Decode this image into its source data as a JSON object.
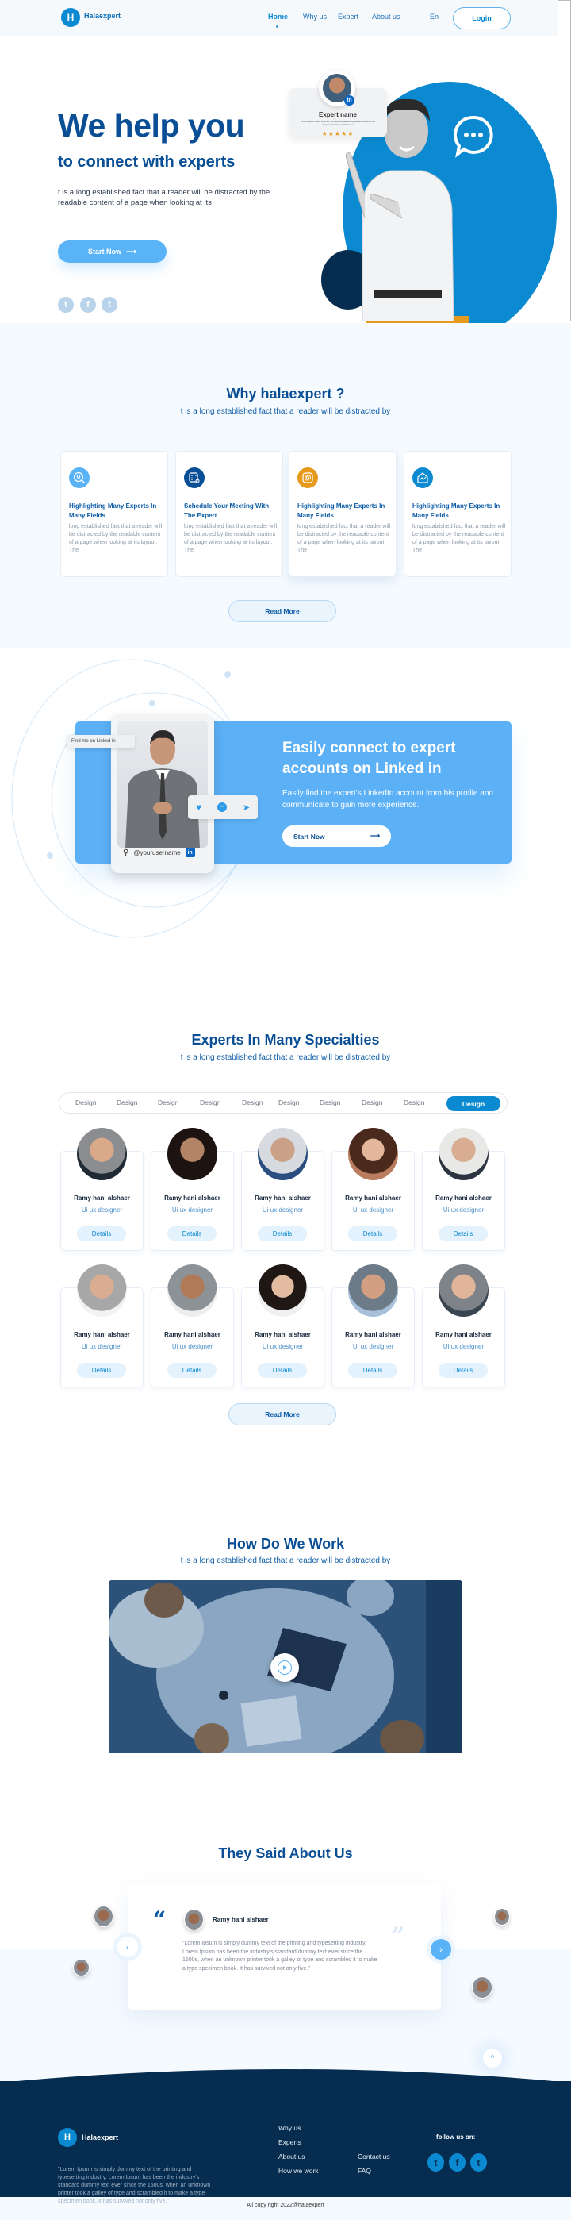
{
  "nav": {
    "brand_initial": "H",
    "brand": "Halaexpert",
    "links": [
      "Home",
      "Why us",
      "Expert",
      "About us"
    ],
    "active": "Home",
    "language": "En",
    "login_label": "Login"
  },
  "hero": {
    "title": "We help you",
    "subtitle": "to connect with experts",
    "description": "t is a long established fact that a reader will be distracted by the readable content of a page when looking at its",
    "cta_label": "Start Now",
    "cta_arrow": "⟶",
    "socials": [
      "twitter-icon",
      "facebook-icon",
      "twitter-icon"
    ],
    "expert_card": {
      "name": "Expert name",
      "text": "Lorem ipsum dolor sit amet, consectetur adipiscing elit sed do eiusmod tempor incididunt ut labore et.",
      "stars": "★★★★★",
      "badge": "in"
    },
    "accent_colors": {
      "blue": "#0b8ad1",
      "navy": "#062c4f",
      "orange": "#e69a1c"
    }
  },
  "why": {
    "title": "Why halaexpert ?",
    "subtitle": "t is a long established fact that a reader will be distracted by",
    "cards": [
      {
        "icon": "user-search-icon",
        "color": "#5bb3f7",
        "title": "Highlighting Many Experts In Many Fields",
        "text": "long established fact that a reader will be distracted by the readable content of a page when looking at its layout. The"
      },
      {
        "icon": "calendar-search-icon",
        "color": "#0a4f96",
        "title": "Schedule Your Meeting With The Expert",
        "text": "long established fact that a reader will be distracted by the readable content of a page when looking at its layout. The"
      },
      {
        "icon": "link-icon",
        "color": "#e69a1c",
        "title": "Highlighting Many Experts In Many Fields",
        "text": "long established fact that a reader will be distracted by the readable content of a page when looking at its layout. The"
      },
      {
        "icon": "chart-up-icon",
        "color": "#0b8ad1",
        "title": "Highlighting Many Experts In Many Fields",
        "text": "long established fact that a reader will be distracted by the readable content of a page when looking at its layout. The"
      }
    ],
    "read_more": "Read More"
  },
  "linkedin": {
    "find_me": "Find me on Linked in",
    "username": "@yourusername",
    "badge": "in",
    "title": "Easily connect to expert accounts on  Linked in",
    "description": "Easily find the expert's LinkedIn account from his profile and communicate to gain more experience.",
    "cta_label": "Start Now",
    "cta_arrow": "⟶"
  },
  "experts": {
    "title": "Experts In Many Specialties",
    "subtitle": "t is a long established fact that a reader will be distracted by",
    "filters": [
      "Design",
      "Design",
      "Design",
      "Design",
      "Design",
      "Design",
      "Design",
      "Design",
      "Design",
      "Design"
    ],
    "active_filter_index": 9,
    "cards": [
      {
        "name": "Ramy hani alshaer",
        "role": "Ui ux designer",
        "details": "Details"
      },
      {
        "name": "Ramy hani alshaer",
        "role": "Ui ux designer",
        "details": "Details"
      },
      {
        "name": "Ramy hani alshaer",
        "role": "Ui ux designer",
        "details": "Details"
      },
      {
        "name": "Ramy hani alshaer",
        "role": "Ui ux designer",
        "details": "Details"
      },
      {
        "name": "Ramy hani alshaer",
        "role": "Ui ux designer",
        "details": "Details"
      },
      {
        "name": "Ramy hani alshaer",
        "role": "Ui ux designer",
        "details": "Details"
      },
      {
        "name": "Ramy hani alshaer",
        "role": "Ui ux designer",
        "details": "Details"
      },
      {
        "name": "Ramy hani alshaer",
        "role": "Ui ux designer",
        "details": "Details"
      },
      {
        "name": "Ramy hani alshaer",
        "role": "Ui ux designer",
        "details": "Details"
      },
      {
        "name": "Ramy hani alshaer",
        "role": "Ui ux designer",
        "details": "Details"
      }
    ],
    "read_more": "Read More"
  },
  "how": {
    "title": "How Do We Work",
    "subtitle": "t is a long established fact that a reader will be distracted by"
  },
  "testimonials": {
    "title": "They Said About Us",
    "name": "Ramy hani alshaer",
    "quote": "\"Lorem Ipsum is simply dummy text of the printing and typesetting industry. Lorem Ipsum has been the industry's standard dummy text ever since the 1500s, when an unknown printer took a galley of type and scrambled it to make a type specimen book. It has survived not only five.\"",
    "open_quote": "“",
    "close_quote": "”",
    "prev": "‹",
    "next": "›",
    "to_top": "^"
  },
  "footer": {
    "brand_initial": "H",
    "brand": "Halaexpert",
    "description": "\"Lorem Ipsum is simply dummy text of the printing and typesetting industry. Lorem Ipsum has been the industry's standard dummy text ever since the 1500s, when an unknown printer took a galley of type and scrambled it to make a type specimen book. It has survived not only five.\"",
    "links_col1": [
      "Why us",
      "Experts",
      "About us",
      "How we work"
    ],
    "links_col2": [
      "Contact us",
      "FAQ"
    ],
    "follow": "follow us on:",
    "socials": [
      "twitter-icon",
      "facebook-icon",
      "twitter-icon"
    ],
    "copyright": "All copy right 2022@halaexpert"
  }
}
